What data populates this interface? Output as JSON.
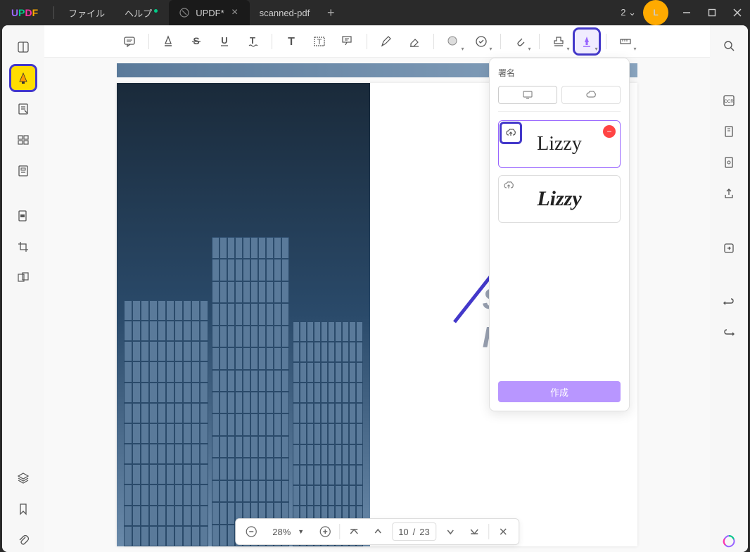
{
  "menu": {
    "file": "ファイル",
    "help": "ヘルプ"
  },
  "tabs": [
    {
      "title": "UPDF*",
      "active": true
    },
    {
      "title": "scanned-pdf",
      "active": false
    }
  ],
  "user": {
    "initial": "L",
    "badge": "2"
  },
  "signature_panel": {
    "title": "署名",
    "sig1": "Lizzy",
    "sig2": "Lizzy",
    "create": "作成"
  },
  "watermark": {
    "line1": "SOFTV",
    "line2": "HIGHLI"
  },
  "zoom": "28%",
  "page": {
    "current": "10",
    "total": "23",
    "sep": "/"
  }
}
